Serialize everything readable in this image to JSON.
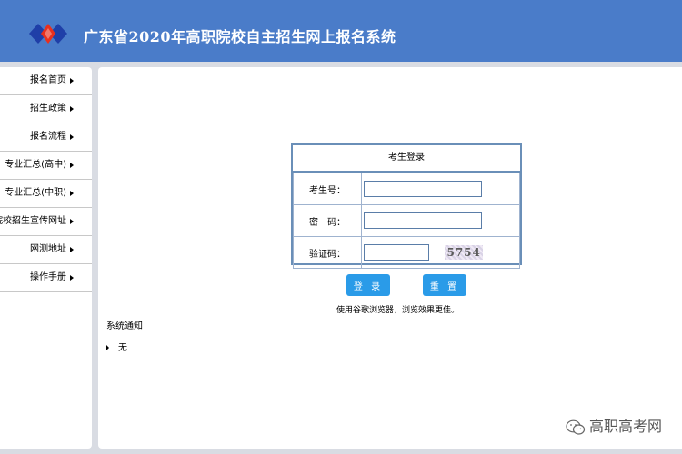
{
  "header": {
    "title": "广东省2020年高职院校自主招生网上报名系统",
    "logo_colors": [
      "#e8301e",
      "#1f3fa8"
    ]
  },
  "sidebar": {
    "items": [
      {
        "label": "报名首页"
      },
      {
        "label": "招生政策"
      },
      {
        "label": "报名流程"
      },
      {
        "label": "专业汇总(高中)"
      },
      {
        "label": "专业汇总(中职)"
      },
      {
        "label": "院校招生宣传网址"
      },
      {
        "label": "网测地址"
      },
      {
        "label": "操作手册"
      }
    ]
  },
  "login": {
    "title": "考生登录",
    "fields": {
      "id_label": "考生号：",
      "id_value": "",
      "password_label": "密　码：",
      "password_value": "",
      "captcha_label": "验证码：",
      "captcha_value": "",
      "captcha_image_text": "5754"
    },
    "login_button": "登 录",
    "reset_button": "重 置",
    "hint": "使用谷歌浏览器，浏览效果更佳。"
  },
  "notice": {
    "title": "系统通知",
    "items": [
      "无"
    ]
  },
  "watermark": {
    "text": "高职高考网"
  },
  "colors": {
    "header_bg": "#4a7cc9",
    "button_bg": "#2a9be8",
    "box_border": "#6a8fb8",
    "page_bg": "#d9dce3"
  }
}
